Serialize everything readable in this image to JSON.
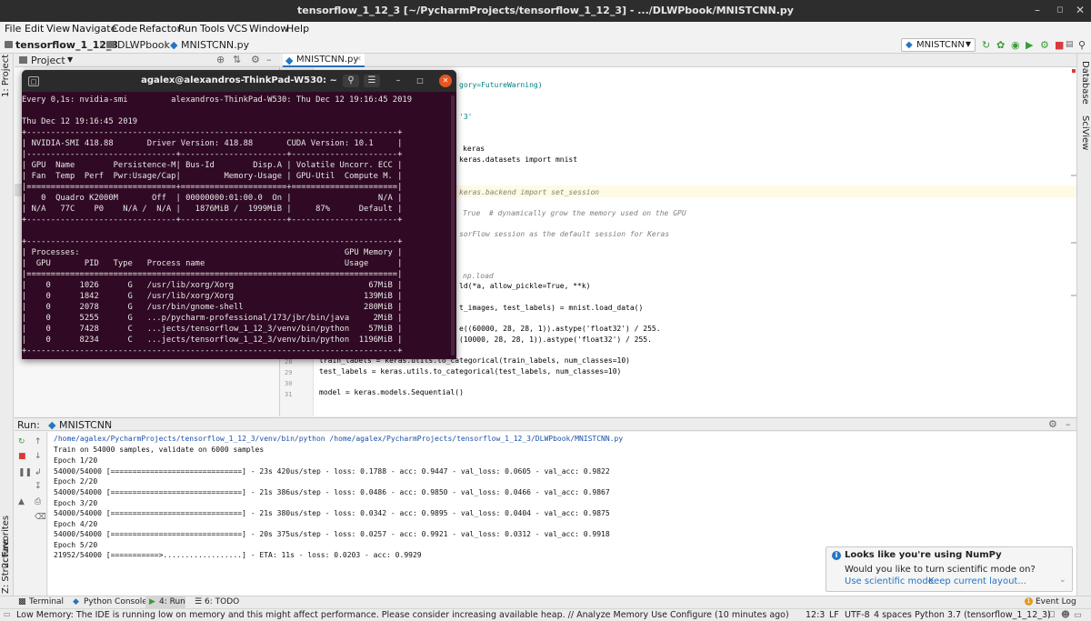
{
  "window": {
    "title": "tensorflow_1_12_3 [~/PycharmProjects/tensorflow_1_12_3] - .../DLWPbook/MNISTCNN.py"
  },
  "menu": [
    "File",
    "Edit",
    "View",
    "Navigate",
    "Code",
    "Refactor",
    "Run",
    "Tools",
    "VCS",
    "Window",
    "Help"
  ],
  "breadcrumb": {
    "project": "tensorflow_1_12_3",
    "folder": "DLWPbook",
    "file": "MNISTCNN.py"
  },
  "toolbar": {
    "run_config": "MNISTCNN"
  },
  "project_panel": {
    "title": "Project"
  },
  "side_tabs": {
    "project": "1: Project",
    "favorites": "2: Favorites",
    "structure": "Z: Structure",
    "database": "Database",
    "sciview": "SciView"
  },
  "editor": {
    "tab": "MNISTCNN.py",
    "lines": [
      {
        "text": "gory=FutureWarning)"
      },
      {
        "text": "'3'"
      },
      {
        "text": "keras"
      },
      {
        "text": "keras.datasets import mnist"
      },
      {
        "text": "keras.backend import set_session"
      },
      {
        "text": "True  # dynamically grow the memory used on the GPU"
      },
      {
        "text": "sorFlow session as the default session for Keras"
      },
      {
        "text": "np.load"
      },
      {
        "text": "ld(*a, allow_pickle=True, **k)"
      },
      {
        "text": "t_images, test_labels) = mnist.load_data()"
      },
      {
        "text": "e((60000, 28, 28, 1)).astype('float32') / 255."
      },
      {
        "text": "(10000, 28, 28, 1)).astype('float32') / 255."
      },
      {
        "text": "train_labels = keras.utils.to_categorical(train_labels, num_classes=10)"
      },
      {
        "text": "test_labels = keras.utils.to_categorical(test_labels, num_classes=10)"
      },
      {
        "text": "model = keras.models.Sequential()"
      }
    ],
    "line_numbers": [
      "28",
      "29",
      "30",
      "31"
    ]
  },
  "terminal": {
    "title": "agalex@alexandros-ThinkPad-W530: ~",
    "lines": [
      "Every 0,1s: nvidia-smi         alexandros-ThinkPad-W530: Thu Dec 12 19:16:45 2019",
      "",
      "Thu Dec 12 19:16:45 2019",
      "+-----------------------------------------------------------------------------+",
      "| NVIDIA-SMI 418.88       Driver Version: 418.88       CUDA Version: 10.1     |",
      "|-------------------------------+----------------------+----------------------+",
      "| GPU  Name        Persistence-M| Bus-Id        Disp.A | Volatile Uncorr. ECC |",
      "| Fan  Temp  Perf  Pwr:Usage/Cap|         Memory-Usage | GPU-Util  Compute M. |",
      "|===============================+======================+======================|",
      "|   0  Quadro K2000M       Off  | 00000000:01:00.0  On |                  N/A |",
      "| N/A   77C    P0    N/A /  N/A |   1876MiB /  1999MiB |     87%      Default |",
      "+-------------------------------+----------------------+----------------------+",
      "",
      "+-----------------------------------------------------------------------------+",
      "| Processes:                                                       GPU Memory |",
      "|  GPU       PID   Type   Process name                             Usage      |",
      "|=============================================================================|",
      "|    0      1026      G   /usr/lib/xorg/Xorg                            67MiB |",
      "|    0      1842      G   /usr/lib/xorg/Xorg                           139MiB |",
      "|    0      2078      G   /usr/bin/gnome-shell                         280MiB |",
      "|    0      5255      G   ...p/pycharm-professional/173/jbr/bin/java     2MiB |",
      "|    0      7428      C   ...jects/tensorflow_1_12_3/venv/bin/python    57MiB |",
      "|    0      8234      C   ...jects/tensorflow_1_12_3/venv/bin/python  1196MiB |",
      "+-----------------------------------------------------------------------------+"
    ]
  },
  "run_panel": {
    "label": "Run:",
    "tab": "MNISTCNN",
    "lines": [
      "/home/agalex/PycharmProjects/tensorflow_1_12_3/venv/bin/python /home/agalex/PycharmProjects/tensorflow_1_12_3/DLWPbook/MNISTCNN.py",
      "Train on 54000 samples, validate on 6000 samples",
      "Epoch 1/20",
      "54000/54000 [==============================] - 23s 420us/step - loss: 0.1788 - acc: 0.9447 - val_loss: 0.0605 - val_acc: 0.9822",
      "Epoch 2/20",
      "54000/54000 [==============================] - 21s 386us/step - loss: 0.0486 - acc: 0.9850 - val_loss: 0.0466 - val_acc: 0.9867",
      "Epoch 3/20",
      "54000/54000 [==============================] - 21s 380us/step - loss: 0.0342 - acc: 0.9895 - val_loss: 0.0404 - val_acc: 0.9875",
      "Epoch 4/20",
      "54000/54000 [==============================] - 20s 375us/step - loss: 0.0257 - acc: 0.9921 - val_loss: 0.0312 - val_acc: 0.9918",
      "Epoch 5/20",
      "21952/54000 [===========>..................] - ETA: 11s - loss: 0.0203 - acc: 0.9929"
    ]
  },
  "notification": {
    "title": "Looks like you're using NumPy",
    "body": "Would you like to turn scientific mode on?",
    "link1": "Use scientific mode",
    "link2": "Keep current layout..."
  },
  "bottom_tabs": {
    "terminal": "Terminal",
    "python_console": "Python Console",
    "run": "4: Run",
    "todo": "6: TODO",
    "event_log": "Event Log"
  },
  "status": {
    "message": "Low Memory: The IDE is running low on memory and this might affect performance. Please consider increasing available heap. // Analyze Memory Use  Configure (10 minutes ago)",
    "position": "12:3",
    "line_sep": "LF",
    "encoding": "UTF-8",
    "indent": "4 spaces",
    "interpreter": "Python 3.7 (tensorflow_1_12_3)"
  },
  "colors": {
    "terminal_bg": "#300a24",
    "accent": "#2675bf",
    "close_orange": "#e95420"
  }
}
